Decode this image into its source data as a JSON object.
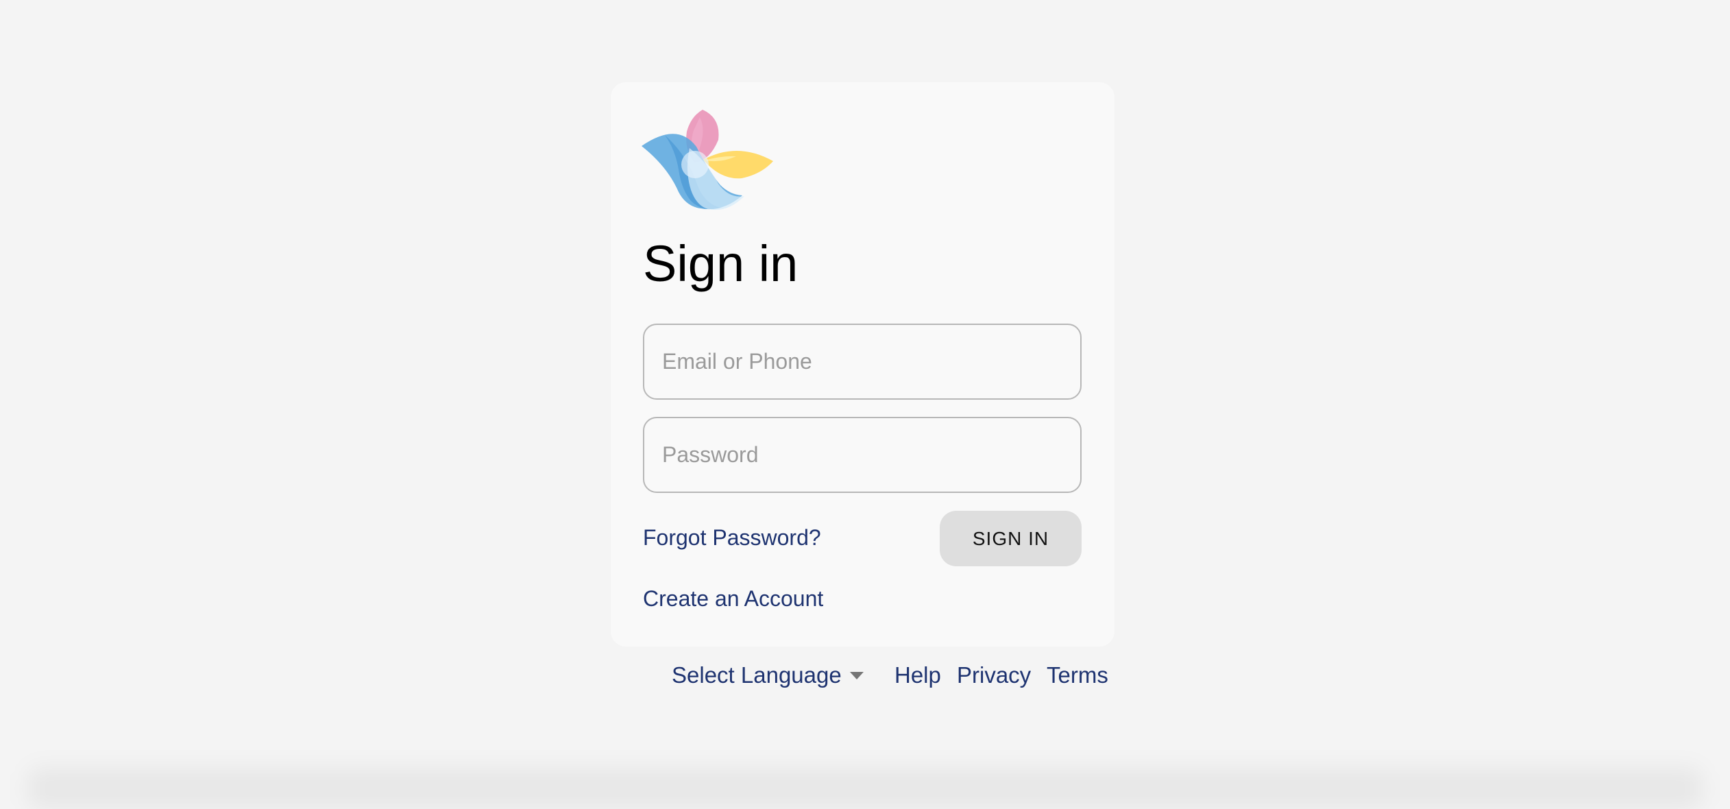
{
  "brand": {
    "logo_colors": {
      "blue": "#5ba7de",
      "light_blue": "#a8d0f0",
      "pink": "#e889b1",
      "yellow": "#ffd861"
    }
  },
  "form": {
    "title": "Sign in",
    "email_placeholder": "Email or Phone",
    "password_placeholder": "Password",
    "forgot_password": "Forgot Password?",
    "sign_in_button": "SIGN IN",
    "create_account": "Create an Account"
  },
  "footer": {
    "theme_toggle_icon": "moon-icon",
    "language_label": "Select Language",
    "language_dropdown_icon": "caret-down-icon",
    "links": {
      "help": "Help",
      "privacy": "Privacy",
      "terms": "Terms"
    }
  },
  "colors": {
    "page_background": "#f4f4f4",
    "card_background": "#f9f9f9",
    "link": "#1e3370",
    "button_background": "#dedede"
  }
}
